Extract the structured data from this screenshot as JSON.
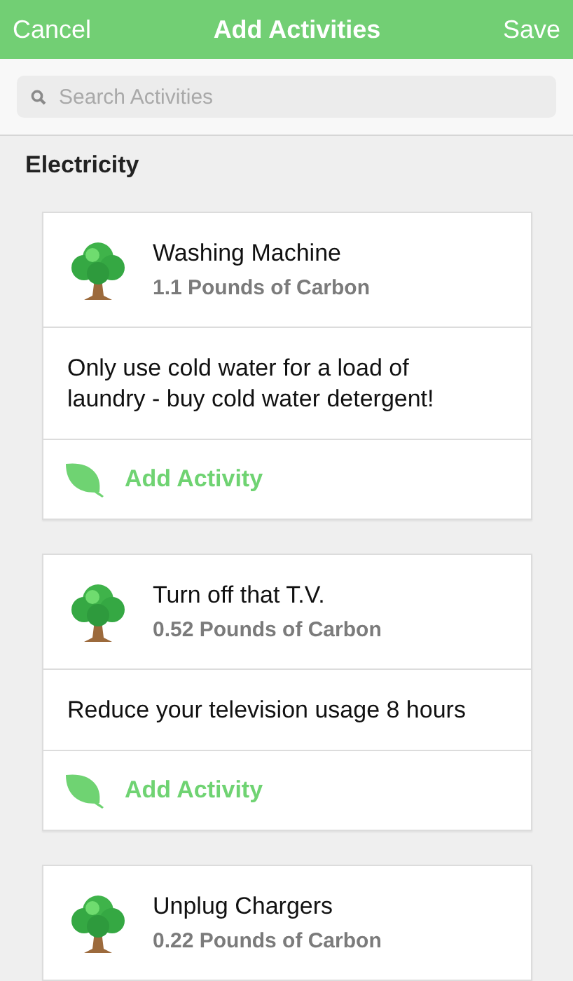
{
  "nav_bar": {
    "left_button": "Cancel",
    "title": "Add Activities",
    "right_button": "Save"
  },
  "search": {
    "placeholder": "Search Activities"
  },
  "section": {
    "title": "Electricity"
  },
  "activities": [
    {
      "name": "Washing Machine",
      "carbon": "1.1 Pounds of Carbon",
      "description": "Only use cold water for a load of laundry - buy cold water detergent!",
      "action": "Add Activity"
    },
    {
      "name": "Turn off that T.V.",
      "carbon": "0.52 Pounds of Carbon",
      "description": "Reduce your television usage 8 hours",
      "action": "Add Activity"
    },
    {
      "name": "Unplug Chargers",
      "carbon": "0.22 Pounds of Carbon"
    }
  ]
}
